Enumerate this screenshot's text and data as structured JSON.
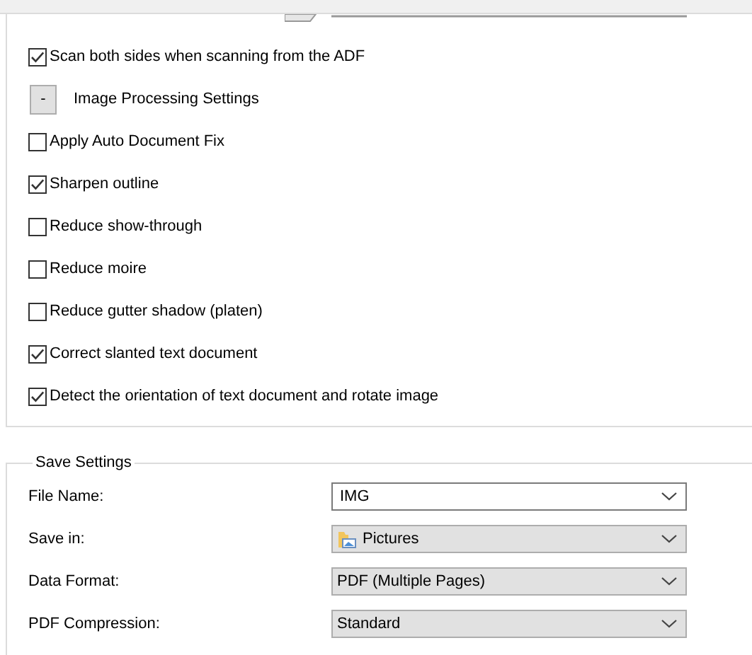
{
  "scan_options": [
    {
      "kind": "checkbox",
      "label": "Scan both sides when scanning from the ADF",
      "checked": true
    },
    {
      "kind": "section",
      "label": "Image Processing Settings",
      "toggle": "-"
    },
    {
      "kind": "checkbox",
      "label": "Apply Auto Document Fix",
      "checked": false
    },
    {
      "kind": "checkbox",
      "label": "Sharpen outline",
      "checked": true
    },
    {
      "kind": "checkbox",
      "label": "Reduce show-through",
      "checked": false
    },
    {
      "kind": "checkbox",
      "label": "Reduce moire",
      "checked": false
    },
    {
      "kind": "checkbox",
      "label": "Reduce gutter shadow (platen)",
      "checked": false
    },
    {
      "kind": "checkbox",
      "label": "Correct slanted text document",
      "checked": true
    },
    {
      "kind": "checkbox",
      "label": "Detect the orientation of text document and rotate image",
      "checked": true
    }
  ],
  "save_settings": {
    "title": "Save Settings",
    "fields": [
      {
        "label": "File Name:",
        "value": "IMG",
        "kind": "editable"
      },
      {
        "label": "Save in:",
        "value": "Pictures",
        "kind": "folder"
      },
      {
        "label": "Data Format:",
        "value": "PDF (Multiple Pages)",
        "kind": "list"
      },
      {
        "label": "PDF Compression:",
        "value": "Standard",
        "kind": "list"
      }
    ]
  }
}
